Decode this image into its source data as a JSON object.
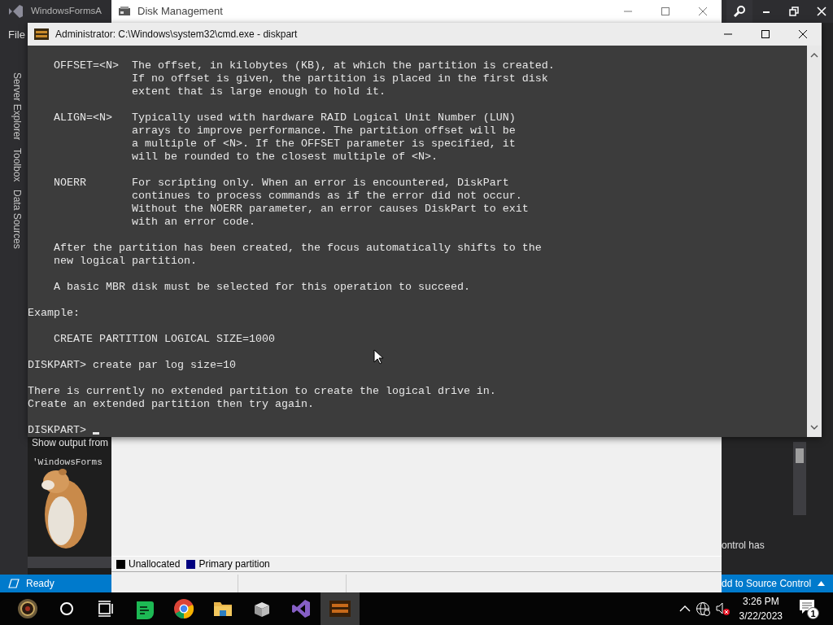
{
  "vs": {
    "title": "WindowsFormsA",
    "menu": [
      "File"
    ],
    "side_tabs": [
      "Server Explorer",
      "Toolbox",
      "Data Sources"
    ],
    "output": {
      "label": "Show output from",
      "lines": [
        "'WindowsForms"
      ]
    },
    "right_panel_text": "ontrol has",
    "status": "Ready",
    "source_control": "dd to Source Control"
  },
  "disk_management": {
    "title": "Disk Management",
    "legend": [
      {
        "label": "Unallocated",
        "color": "#000000"
      },
      {
        "label": "Primary partition",
        "color": "#000080"
      }
    ]
  },
  "cmd": {
    "title": "Administrator: C:\\Windows\\system32\\cmd.exe - diskpart",
    "blocks": [
      [
        "    OFFSET=<N>  The offset, in kilobytes (KB), at which the partition is created.",
        "                If no offset is given, the partition is placed in the first disk",
        "                extent that is large enough to hold it."
      ],
      [
        "    ALIGN=<N>   Typically used with hardware RAID Logical Unit Number (LUN)",
        "                arrays to improve performance. The partition offset will be",
        "                a multiple of <N>. If the OFFSET parameter is specified, it",
        "                will be rounded to the closest multiple of <N>."
      ],
      [
        "    NOERR       For scripting only. When an error is encountered, DiskPart",
        "                continues to process commands as if the error did not occur.",
        "                Without the NOERR parameter, an error causes DiskPart to exit",
        "                with an error code."
      ],
      [
        "    After the partition has been created, the focus automatically shifts to the",
        "    new logical partition."
      ],
      [
        "    A basic MBR disk must be selected for this operation to succeed."
      ],
      [
        "Example:"
      ],
      [
        "    CREATE PARTITION LOGICAL SIZE=1000"
      ],
      [
        "DISKPART> create par log size=10"
      ],
      [
        "There is currently no extended partition to create the logical drive in.",
        "Create an extended partition then try again."
      ],
      [
        "DISKPART> "
      ]
    ]
  },
  "taskbar": {
    "time": "3:26 PM",
    "date": "3/22/2023",
    "notifications": "1"
  }
}
